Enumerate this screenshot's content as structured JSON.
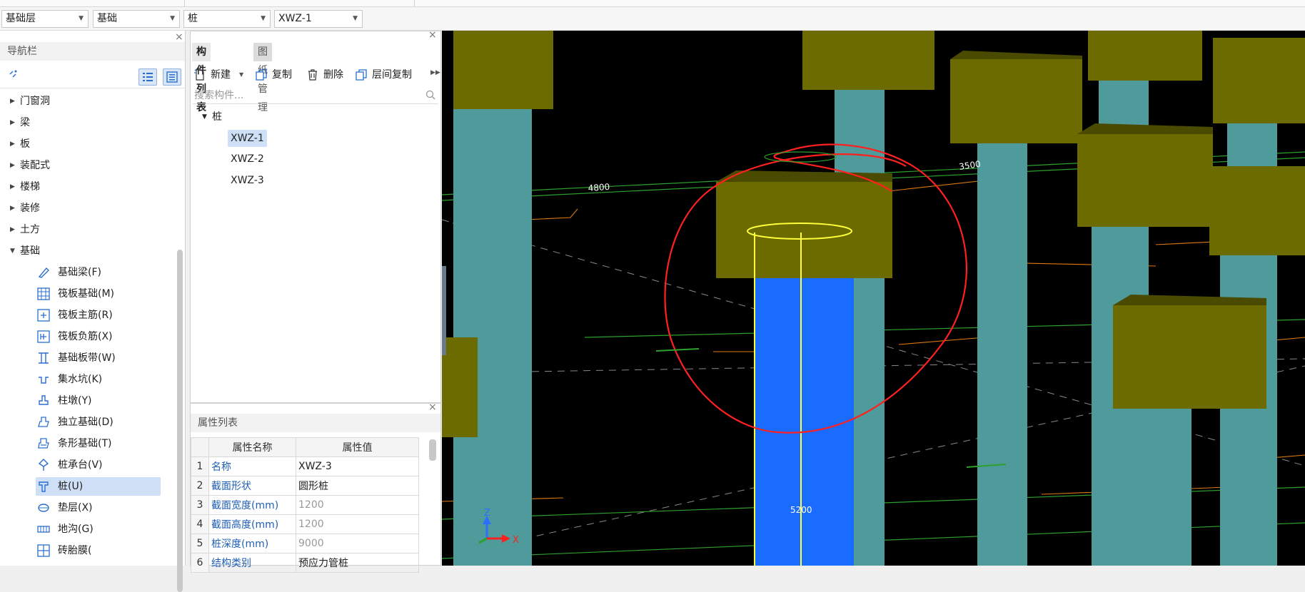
{
  "toolbar": {
    "floor": "基础层",
    "category": "基础",
    "type": "桩",
    "component": "XWZ-1"
  },
  "nav": {
    "title": "导航栏",
    "groups": [
      {
        "label": "门窗洞",
        "expanded": false
      },
      {
        "label": "梁",
        "expanded": false
      },
      {
        "label": "板",
        "expanded": false
      },
      {
        "label": "装配式",
        "expanded": false
      },
      {
        "label": "楼梯",
        "expanded": false
      },
      {
        "label": "装修",
        "expanded": false
      },
      {
        "label": "土方",
        "expanded": false
      },
      {
        "label": "基础",
        "expanded": true
      }
    ],
    "foundation_items": [
      {
        "label": "基础梁(F)",
        "icon": "foundation-beam-icon"
      },
      {
        "label": "筏板基础(M)",
        "icon": "raft-foundation-icon"
      },
      {
        "label": "筏板主筋(R)",
        "icon": "raft-main-rebar-icon"
      },
      {
        "label": "筏板负筋(X)",
        "icon": "raft-negative-rebar-icon"
      },
      {
        "label": "基础板带(W)",
        "icon": "foundation-strip-icon"
      },
      {
        "label": "集水坑(K)",
        "icon": "sump-pit-icon"
      },
      {
        "label": "柱墩(Y)",
        "icon": "column-pier-icon"
      },
      {
        "label": "独立基础(D)",
        "icon": "isolated-footing-icon"
      },
      {
        "label": "条形基础(T)",
        "icon": "strip-footing-icon"
      },
      {
        "label": "桩承台(V)",
        "icon": "pile-cap-icon"
      },
      {
        "label": "桩(U)",
        "icon": "pile-icon",
        "selected": true
      },
      {
        "label": "垫层(X)",
        "icon": "cushion-icon"
      },
      {
        "label": "地沟(G)",
        "icon": "trench-icon"
      },
      {
        "label": "砖胎膜(",
        "icon": "brick-mold-icon"
      }
    ]
  },
  "component_panel": {
    "tabs": [
      "构件列表",
      "图纸管理"
    ],
    "actions": {
      "new": "新建",
      "copy": "复制",
      "delete": "删除",
      "floor_copy": "层间复制"
    },
    "search_placeholder": "搜索构件...",
    "tree_root": "桩",
    "items": [
      "XWZ-1",
      "XWZ-2",
      "XWZ-3"
    ],
    "selected": "XWZ-1"
  },
  "properties": {
    "title": "属性列表",
    "headers": {
      "name": "属性名称",
      "value": "属性值"
    },
    "rows": [
      {
        "no": "1",
        "name": "名称",
        "value": "XWZ-3",
        "grey": false
      },
      {
        "no": "2",
        "name": "截面形状",
        "value": "圆形桩",
        "grey": false
      },
      {
        "no": "3",
        "name": "截面宽度(mm)",
        "value": "1200",
        "grey": true
      },
      {
        "no": "4",
        "name": "截面高度(mm)",
        "value": "1200",
        "grey": true
      },
      {
        "no": "5",
        "name": "桩深度(mm)",
        "value": "9000",
        "grey": true
      },
      {
        "no": "6",
        "name": "结构类别",
        "value": "预应力管桩",
        "grey": false
      }
    ]
  },
  "viewport": {
    "dims": [
      "4800",
      "3500",
      "5200"
    ],
    "axes": {
      "x": "X",
      "z": "Z"
    },
    "colors": {
      "pile": "#4f9a9a",
      "pile_selected": "#1a6cff",
      "cap": "#6b6b00",
      "highlight": "#ffff3a",
      "annotation": "#ff2020"
    }
  }
}
